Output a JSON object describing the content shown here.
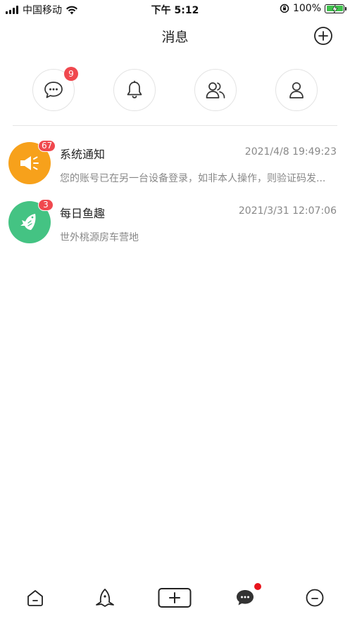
{
  "status_bar": {
    "carrier": "中国移动",
    "time": "下午 5:12",
    "battery_pct": "100%",
    "battery_level": 1.0,
    "icons": [
      "signal-icon",
      "wifi-icon",
      "orientation-lock-icon",
      "battery-icon"
    ]
  },
  "header": {
    "title": "消息",
    "add_icon": "plus-circle-icon"
  },
  "quick_actions": [
    {
      "icon": "chat-bubble-icon",
      "badge": "9"
    },
    {
      "icon": "bell-icon",
      "badge": ""
    },
    {
      "icon": "users-icon",
      "badge": ""
    },
    {
      "icon": "user-icon",
      "badge": ""
    }
  ],
  "messages": [
    {
      "title": "系统通知",
      "time": "2021/4/8 19:49:23",
      "preview": "您的账号已在另一台设备登录，如非本人操作，则验证码发...",
      "badge": "67",
      "avatar_icon": "megaphone-icon",
      "avatar_color": "#f7a11b"
    },
    {
      "title": "每日鱼趣",
      "time": "2021/3/31 12:07:06",
      "preview": "世外桃源房车营地",
      "badge": "3",
      "avatar_icon": "fish-icon",
      "avatar_color": "#44c383"
    }
  ],
  "tab_bar": {
    "tabs": [
      {
        "icon": "home-icon"
      },
      {
        "icon": "rocket-icon"
      },
      {
        "icon": "add-box-icon"
      },
      {
        "icon": "message-icon",
        "has_dot": true
      },
      {
        "icon": "profile-icon"
      }
    ],
    "dot_color": "#e8141c"
  },
  "colors": {
    "badge": "#f0484e",
    "text_primary": "#222222",
    "text_secondary": "#888888",
    "divider": "#e6e6e6"
  }
}
